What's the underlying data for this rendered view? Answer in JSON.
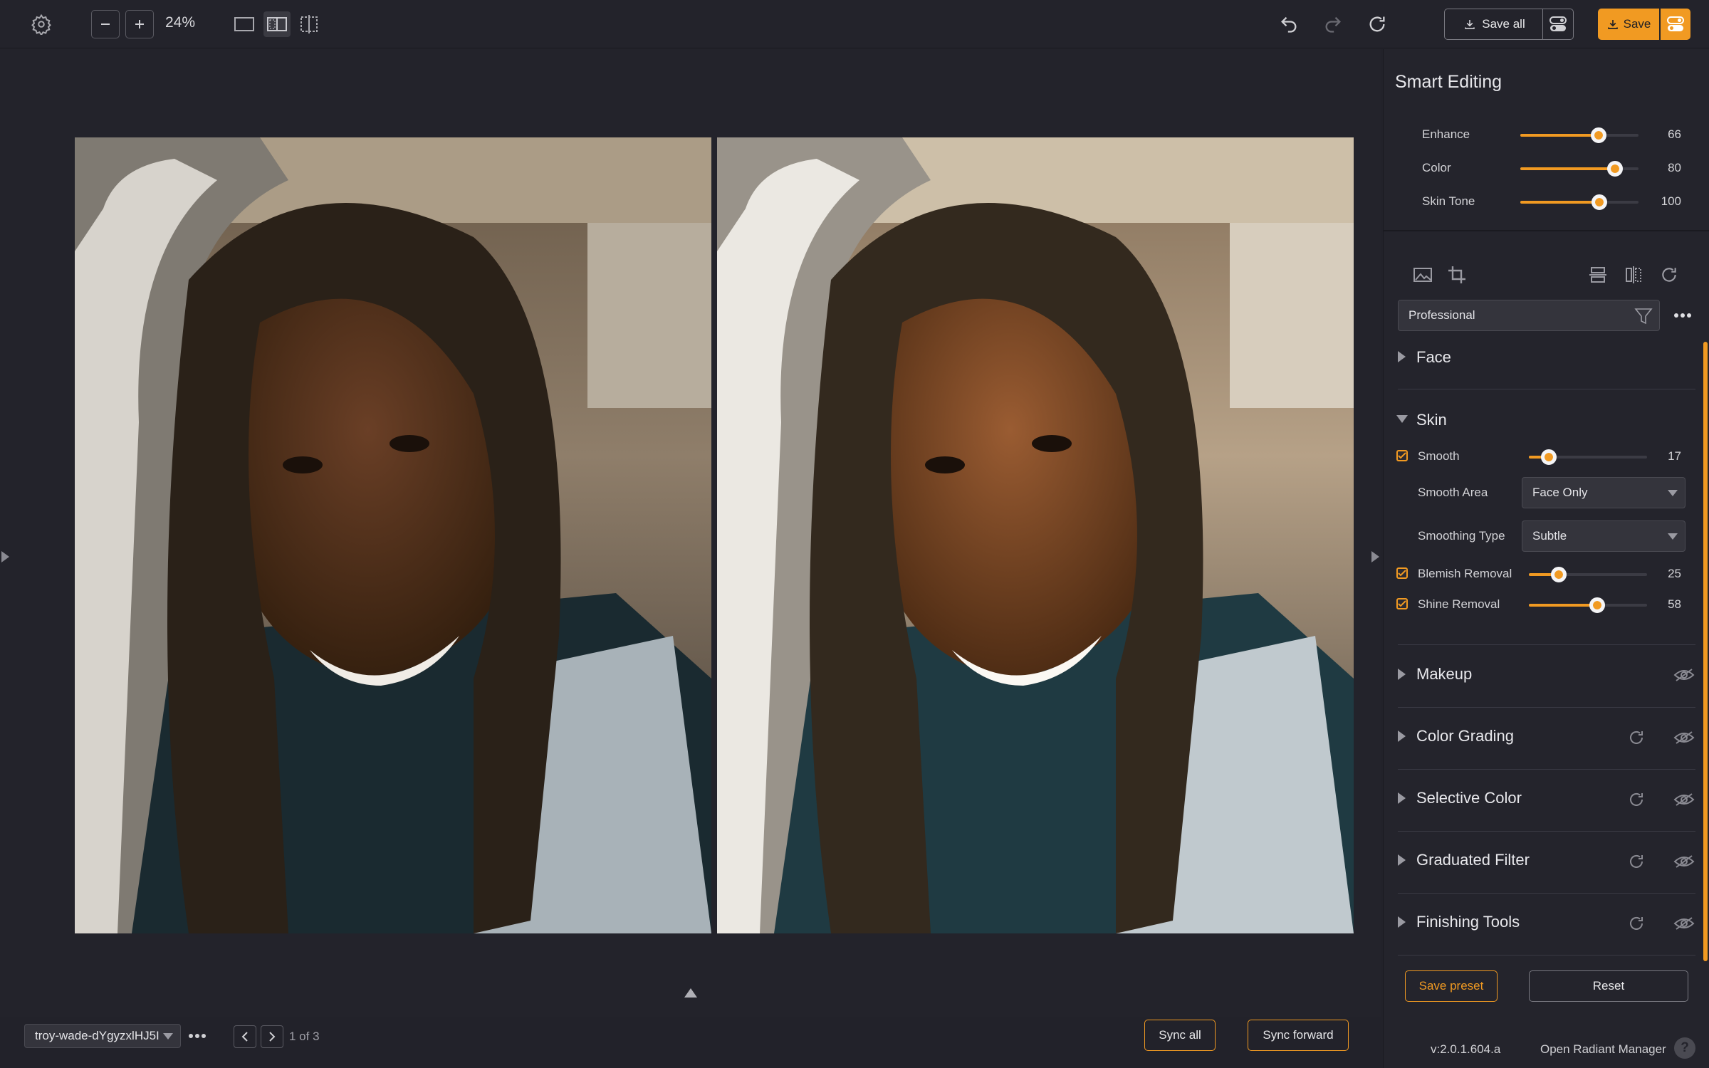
{
  "toolbar": {
    "zoom": "24%",
    "save_all_label": "Save all",
    "save_label": "Save"
  },
  "panel": {
    "title": "Smart Editing",
    "smart_sliders": [
      {
        "label": "Enhance",
        "value": "66",
        "fraction": 0.66
      },
      {
        "label": "Color",
        "value": "80",
        "fraction": 0.8
      },
      {
        "label": "Skin Tone",
        "value": "100",
        "fraction": 0.67
      }
    ],
    "preset_select": "Professional",
    "sections": {
      "face": "Face",
      "skin": "Skin",
      "makeup": "Makeup",
      "color_grading": "Color Grading",
      "selective_color": "Selective Color",
      "graduated_filter": "Graduated Filter",
      "finishing_tools": "Finishing Tools"
    },
    "skin": {
      "smooth_label": "Smooth",
      "smooth_value": "17",
      "smooth_fraction": 0.17,
      "smooth_area_label": "Smooth Area",
      "smooth_area_value": "Face Only",
      "smoothing_type_label": "Smoothing Type",
      "smoothing_type_value": "Subtle",
      "blemish_label": "Blemish Removal",
      "blemish_value": "25",
      "blemish_fraction": 0.25,
      "shine_label": "Shine Removal",
      "shine_value": "58",
      "shine_fraction": 0.58
    },
    "save_preset_label": "Save preset",
    "reset_label": "Reset",
    "version": "v:2.0.1.604.a",
    "radiant_manager": "Open Radiant Manager"
  },
  "bottombar": {
    "filename": "troy-wade-dYgyzxlHJ5I",
    "page": "1 of 3",
    "sync_all": "Sync all",
    "sync_forward": "Sync forward"
  },
  "colors": {
    "accent": "#f19a22",
    "background": "#22222a"
  }
}
